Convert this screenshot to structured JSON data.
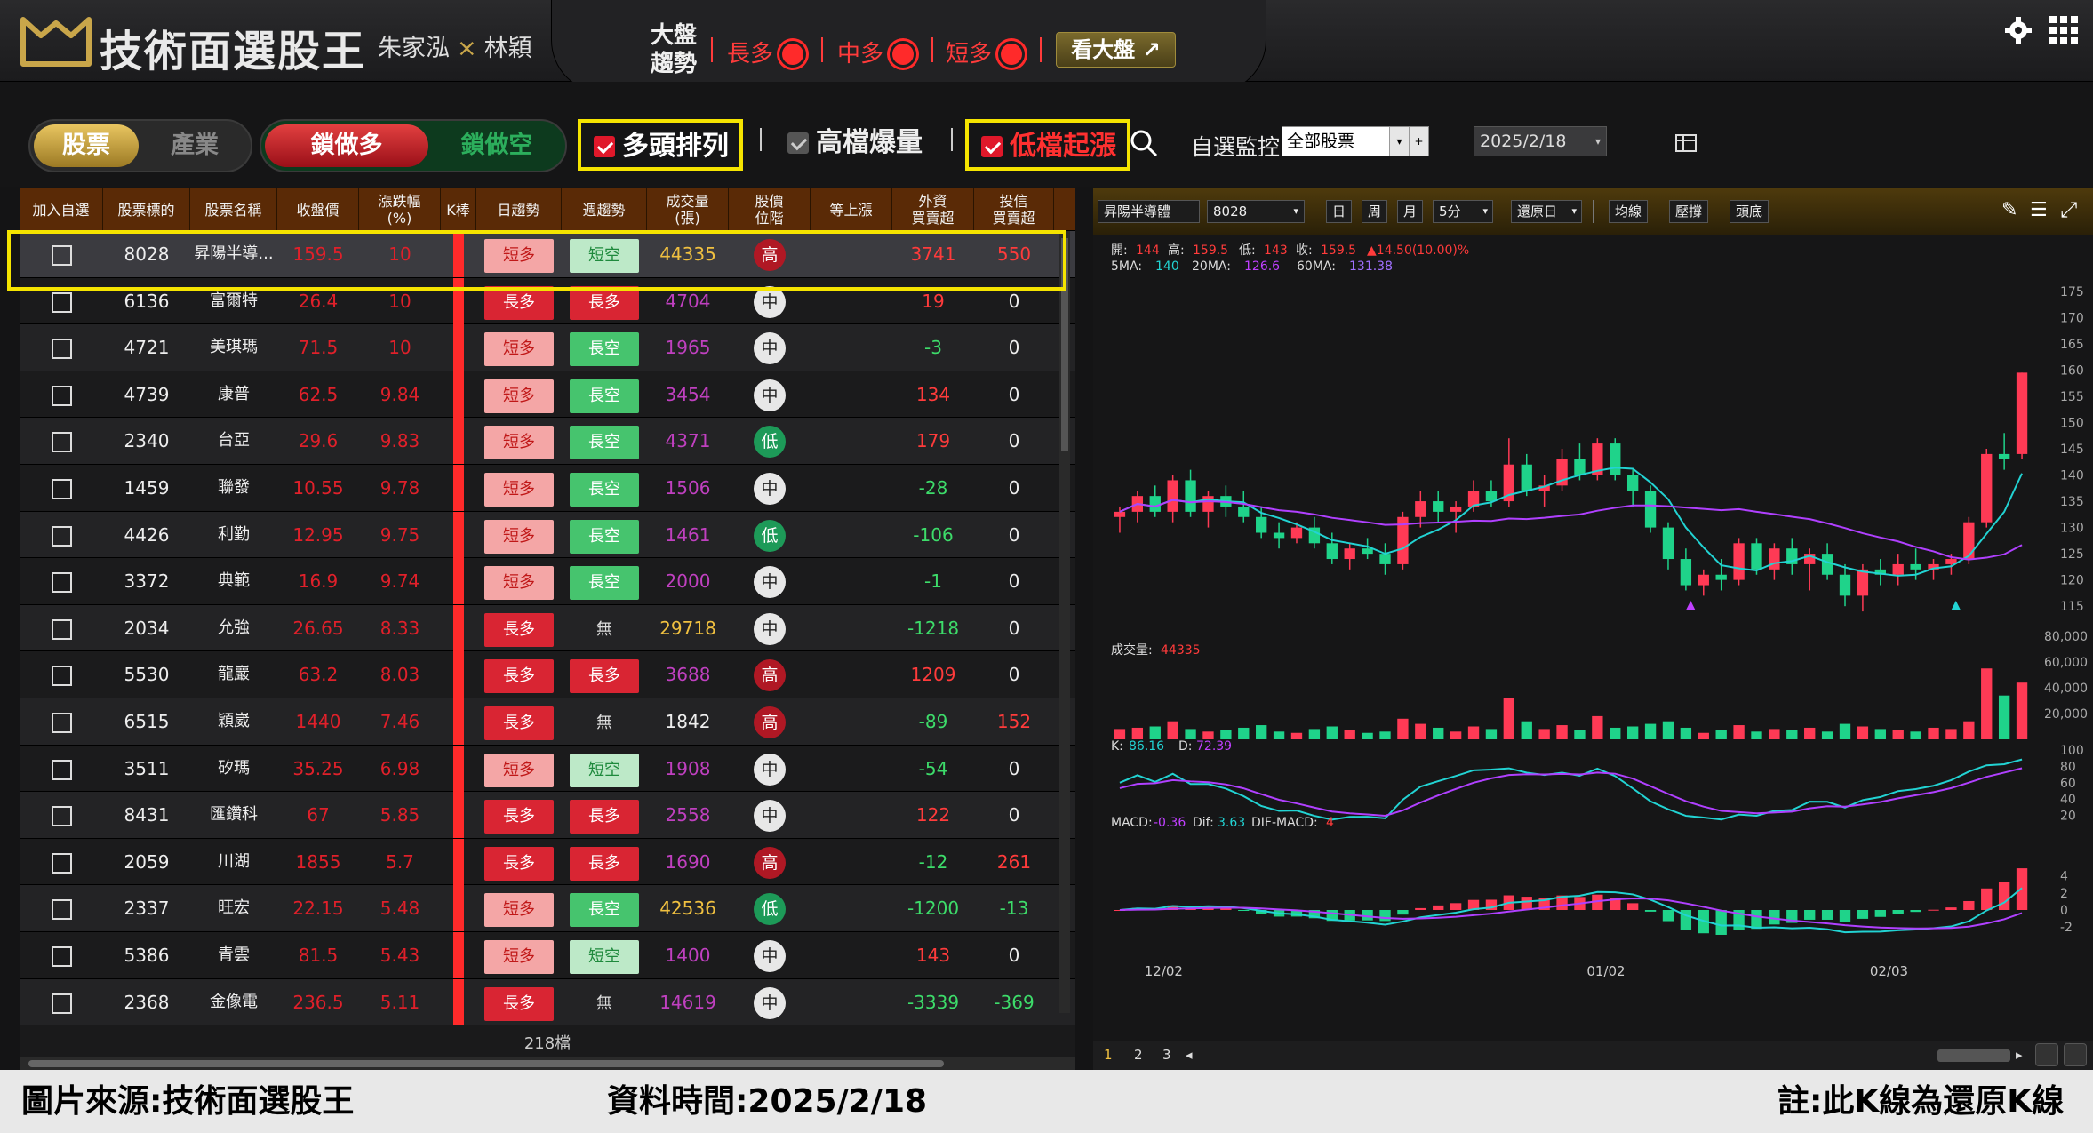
{
  "header": {
    "app_title": "技術面選股王",
    "author1": "朱家泓",
    "author_sep": "×",
    "author2": "林穎",
    "market_title_1": "大盤",
    "market_title_2": "趨勢",
    "trend_long": "長多",
    "trend_mid": "中多",
    "trend_short": "短多",
    "view_market": "看大盤"
  },
  "filters": {
    "stock": "股票",
    "industry": "產業",
    "lock_long": "鎖做多",
    "lock_short": "鎖做空",
    "bull_arrangement": "多頭排列",
    "high_volume": "高檔爆量",
    "low_rise": "低檔起漲",
    "watch_label": "自選監控",
    "watch_value": "全部股票",
    "date": "2025/2/18"
  },
  "table": {
    "headers": [
      "加入自選",
      "股票標的",
      "股票名稱",
      "收盤價",
      "漲跌幅\n(%)",
      "K棒",
      "日趨勢",
      "週趨勢",
      "成交量\n(張)",
      "股價\n位階",
      "等上漲",
      "外資\n買賣超",
      "投信\n買賣超"
    ],
    "rows": [
      {
        "code": "8028",
        "name": "昇陽半導...",
        "close": "159.5",
        "chg": "10",
        "day": "短多",
        "day_style": "pink",
        "week": "短空",
        "week_style": "mint",
        "vol": "44335",
        "vol_color": "#f0c040",
        "pos": "高",
        "pos_style": "hi",
        "foreign": "3741",
        "foreign_color": "#ff3b3b",
        "trust": "550",
        "trust_color": "#ff3b3b"
      },
      {
        "code": "6136",
        "name": "富爾特",
        "close": "26.4",
        "chg": "10",
        "day": "長多",
        "day_style": "red",
        "week": "長多",
        "week_style": "red",
        "vol": "4704",
        "vol_color": "#c040c0",
        "pos": "中",
        "pos_style": "mid",
        "foreign": "19",
        "foreign_color": "#ff3b3b",
        "trust": "0",
        "trust_color": "#eee"
      },
      {
        "code": "4721",
        "name": "美琪瑪",
        "close": "71.5",
        "chg": "10",
        "day": "短多",
        "day_style": "pink",
        "week": "長空",
        "week_style": "green",
        "vol": "1965",
        "vol_color": "#c040c0",
        "pos": "中",
        "pos_style": "mid",
        "foreign": "-3",
        "foreign_color": "#3ddc6a",
        "trust": "0",
        "trust_color": "#eee"
      },
      {
        "code": "4739",
        "name": "康普",
        "close": "62.5",
        "chg": "9.84",
        "day": "短多",
        "day_style": "pink",
        "week": "長空",
        "week_style": "green",
        "vol": "3454",
        "vol_color": "#c040c0",
        "pos": "中",
        "pos_style": "mid",
        "foreign": "134",
        "foreign_color": "#ff3b3b",
        "trust": "0",
        "trust_color": "#eee"
      },
      {
        "code": "2340",
        "name": "台亞",
        "close": "29.6",
        "chg": "9.83",
        "day": "短多",
        "day_style": "pink",
        "week": "長空",
        "week_style": "green",
        "vol": "4371",
        "vol_color": "#c040c0",
        "pos": "低",
        "pos_style": "lo",
        "foreign": "179",
        "foreign_color": "#ff3b3b",
        "trust": "0",
        "trust_color": "#eee"
      },
      {
        "code": "1459",
        "name": "聯發",
        "close": "10.55",
        "chg": "9.78",
        "day": "短多",
        "day_style": "pink",
        "week": "長空",
        "week_style": "green",
        "vol": "1506",
        "vol_color": "#c040c0",
        "pos": "中",
        "pos_style": "mid",
        "foreign": "-28",
        "foreign_color": "#3ddc6a",
        "trust": "0",
        "trust_color": "#eee"
      },
      {
        "code": "4426",
        "name": "利勤",
        "close": "12.95",
        "chg": "9.75",
        "day": "短多",
        "day_style": "pink",
        "week": "長空",
        "week_style": "green",
        "vol": "1461",
        "vol_color": "#c040c0",
        "pos": "低",
        "pos_style": "lo",
        "foreign": "-106",
        "foreign_color": "#3ddc6a",
        "trust": "0",
        "trust_color": "#eee"
      },
      {
        "code": "3372",
        "name": "典範",
        "close": "16.9",
        "chg": "9.74",
        "day": "短多",
        "day_style": "pink",
        "week": "長空",
        "week_style": "green",
        "vol": "2000",
        "vol_color": "#c040c0",
        "pos": "中",
        "pos_style": "mid",
        "foreign": "-1",
        "foreign_color": "#3ddc6a",
        "trust": "0",
        "trust_color": "#eee"
      },
      {
        "code": "2034",
        "name": "允強",
        "close": "26.65",
        "chg": "8.33",
        "day": "長多",
        "day_style": "red",
        "week": "無",
        "week_style": "none",
        "vol": "29718",
        "vol_color": "#f0c040",
        "pos": "中",
        "pos_style": "mid",
        "foreign": "-1218",
        "foreign_color": "#3ddc6a",
        "trust": "0",
        "trust_color": "#eee"
      },
      {
        "code": "5530",
        "name": "龍巖",
        "close": "63.2",
        "chg": "8.03",
        "day": "長多",
        "day_style": "red",
        "week": "長多",
        "week_style": "red",
        "vol": "3688",
        "vol_color": "#c040c0",
        "pos": "高",
        "pos_style": "hi",
        "foreign": "1209",
        "foreign_color": "#ff3b3b",
        "trust": "0",
        "trust_color": "#eee"
      },
      {
        "code": "6515",
        "name": "穎崴",
        "close": "1440",
        "chg": "7.46",
        "day": "長多",
        "day_style": "red",
        "week": "無",
        "week_style": "none",
        "vol": "1842",
        "vol_color": "#eee",
        "pos": "高",
        "pos_style": "hi",
        "foreign": "-89",
        "foreign_color": "#3ddc6a",
        "trust": "152",
        "trust_color": "#ff3b3b"
      },
      {
        "code": "3511",
        "name": "矽瑪",
        "close": "35.25",
        "chg": "6.98",
        "day": "短多",
        "day_style": "pink",
        "week": "短空",
        "week_style": "mint",
        "vol": "1908",
        "vol_color": "#c040c0",
        "pos": "中",
        "pos_style": "mid",
        "foreign": "-54",
        "foreign_color": "#3ddc6a",
        "trust": "0",
        "trust_color": "#eee"
      },
      {
        "code": "8431",
        "name": "匯鑽科",
        "close": "67",
        "chg": "5.85",
        "day": "長多",
        "day_style": "red",
        "week": "長多",
        "week_style": "red",
        "vol": "2558",
        "vol_color": "#c040c0",
        "pos": "中",
        "pos_style": "mid",
        "foreign": "122",
        "foreign_color": "#ff3b3b",
        "trust": "0",
        "trust_color": "#eee"
      },
      {
        "code": "2059",
        "name": "川湖",
        "close": "1855",
        "chg": "5.7",
        "day": "長多",
        "day_style": "red",
        "week": "長多",
        "week_style": "red",
        "vol": "1690",
        "vol_color": "#c040c0",
        "pos": "高",
        "pos_style": "hi",
        "foreign": "-12",
        "foreign_color": "#3ddc6a",
        "trust": "261",
        "trust_color": "#ff3b3b"
      },
      {
        "code": "2337",
        "name": "旺宏",
        "close": "22.15",
        "chg": "5.48",
        "day": "短多",
        "day_style": "pink",
        "week": "長空",
        "week_style": "green",
        "vol": "42536",
        "vol_color": "#f0c040",
        "pos": "低",
        "pos_style": "lo",
        "foreign": "-1200",
        "foreign_color": "#3ddc6a",
        "trust": "-13",
        "trust_color": "#3ddc6a"
      },
      {
        "code": "5386",
        "name": "青雲",
        "close": "81.5",
        "chg": "5.43",
        "day": "短多",
        "day_style": "pink",
        "week": "短空",
        "week_style": "mint",
        "vol": "1400",
        "vol_color": "#c040c0",
        "pos": "中",
        "pos_style": "mid",
        "foreign": "143",
        "foreign_color": "#ff3b3b",
        "trust": "0",
        "trust_color": "#eee"
      },
      {
        "code": "2368",
        "name": "金像電",
        "close": "236.5",
        "chg": "5.11",
        "day": "長多",
        "day_style": "red",
        "week": "無",
        "week_style": "none",
        "vol": "14619",
        "vol_color": "#c040c0",
        "pos": "中",
        "pos_style": "mid",
        "foreign": "-3339",
        "foreign_color": "#3ddc6a",
        "trust": "-369",
        "trust_color": "#3ddc6a"
      }
    ],
    "footer_count": "218檔"
  },
  "chart_toolbar": {
    "stock_name": "昇陽半導體",
    "stock_code": "8028",
    "period_day": "日",
    "period_week": "周",
    "period_month": "月",
    "interval": "5分",
    "restore": "還原日",
    "ma_line": "均線",
    "pressure": "壓撐",
    "top_bottom": "頭底"
  },
  "chart_info": {
    "open_label": "開:",
    "open": "144",
    "high_label": "高:",
    "high": "159.5",
    "low_label": "低:",
    "low": "143",
    "close_label": "收:",
    "close": "159.5",
    "change": "▲14.50(10.00)%",
    "ma5_label": "5MA:",
    "ma5": "140",
    "ma20_label": "20MA:",
    "ma20": "126.6",
    "ma60_label": "60MA:",
    "ma60": "131.38",
    "vol_label": "成交量:",
    "vol": "44335",
    "k_label": "K:",
    "k": "86.16",
    "d_label": "D:",
    "d": "72.39",
    "macd_label": "MACD:",
    "macd": "-0.36",
    "dif_label": "Dif:",
    "dif": "3.63",
    "difmacd_label": "DIF-MACD:",
    "difmacd": "4"
  },
  "chart_data": {
    "type": "candlestick",
    "x_ticks": [
      "12/02",
      "01/02",
      "02/03"
    ],
    "price_axis": [
      "175",
      "170",
      "165",
      "160",
      "155",
      "150",
      "145",
      "140",
      "135",
      "130",
      "125",
      "120",
      "115"
    ],
    "volume_axis": [
      "80,000",
      "60,000",
      "40,000",
      "20,000"
    ],
    "kd_axis": [
      "100",
      "80",
      "60",
      "40",
      "20"
    ],
    "macd_axis": [
      "4",
      "2",
      "0",
      "-2"
    ],
    "ylim_price": [
      113,
      177
    ],
    "candles": [
      [
        132,
        134,
        129,
        133
      ],
      [
        133,
        137,
        131,
        136
      ],
      [
        136,
        138,
        132,
        133
      ],
      [
        133,
        140,
        131,
        139
      ],
      [
        139,
        141,
        132,
        133
      ],
      [
        133,
        137,
        130,
        136
      ],
      [
        136,
        138,
        132,
        134
      ],
      [
        134,
        137,
        131,
        132
      ],
      [
        132,
        134,
        128,
        129
      ],
      [
        129,
        131,
        126,
        128
      ],
      [
        128,
        131,
        127,
        130
      ],
      [
        130,
        132,
        126,
        127
      ],
      [
        127,
        129,
        123,
        124
      ],
      [
        124,
        127,
        122,
        126
      ],
      [
        126,
        128,
        124,
        125
      ],
      [
        125,
        127,
        121,
        123
      ],
      [
        123,
        133,
        122,
        132
      ],
      [
        132,
        137,
        130,
        135
      ],
      [
        135,
        137,
        131,
        133
      ],
      [
        133,
        135,
        129,
        134
      ],
      [
        134,
        139,
        133,
        137
      ],
      [
        137,
        139,
        134,
        135
      ],
      [
        135,
        147,
        134,
        142
      ],
      [
        142,
        144,
        136,
        137
      ],
      [
        137,
        140,
        134,
        138
      ],
      [
        138,
        145,
        137,
        143
      ],
      [
        143,
        146,
        139,
        140
      ],
      [
        140,
        147,
        139,
        146
      ],
      [
        146,
        147,
        139,
        140
      ],
      [
        140,
        141,
        134,
        137
      ],
      [
        137,
        138,
        129,
        130
      ],
      [
        130,
        131,
        122,
        124
      ],
      [
        124,
        126,
        118,
        119
      ],
      [
        119,
        122,
        117,
        121
      ],
      [
        121,
        124,
        118,
        120
      ],
      [
        120,
        128,
        119,
        127
      ],
      [
        127,
        128,
        121,
        122
      ],
      [
        122,
        127,
        120,
        126
      ],
      [
        126,
        128,
        121,
        123
      ],
      [
        123,
        126,
        118,
        125
      ],
      [
        125,
        127,
        120,
        121
      ],
      [
        121,
        123,
        115,
        117
      ],
      [
        117,
        123,
        114,
        122
      ],
      [
        122,
        124,
        119,
        121
      ],
      [
        121,
        125,
        119,
        123
      ],
      [
        123,
        126,
        120,
        122
      ],
      [
        122,
        124,
        120,
        123
      ],
      [
        123,
        125,
        121,
        124
      ],
      [
        124,
        132,
        123,
        131
      ],
      [
        131,
        145,
        130,
        144
      ],
      [
        144,
        148,
        141,
        143
      ],
      [
        144,
        159.5,
        143,
        159.5
      ]
    ],
    "volumes": [
      8,
      9,
      10,
      14,
      8,
      6,
      7,
      9,
      11,
      6,
      5,
      8,
      10,
      7,
      5,
      6,
      16,
      12,
      9,
      6,
      10,
      8,
      32,
      14,
      8,
      11,
      7,
      18,
      9,
      10,
      12,
      14,
      9,
      5,
      7,
      11,
      6,
      8,
      7,
      9,
      6,
      12,
      10,
      8,
      7,
      6,
      9,
      8,
      14,
      55,
      34,
      44
    ]
  }
}
